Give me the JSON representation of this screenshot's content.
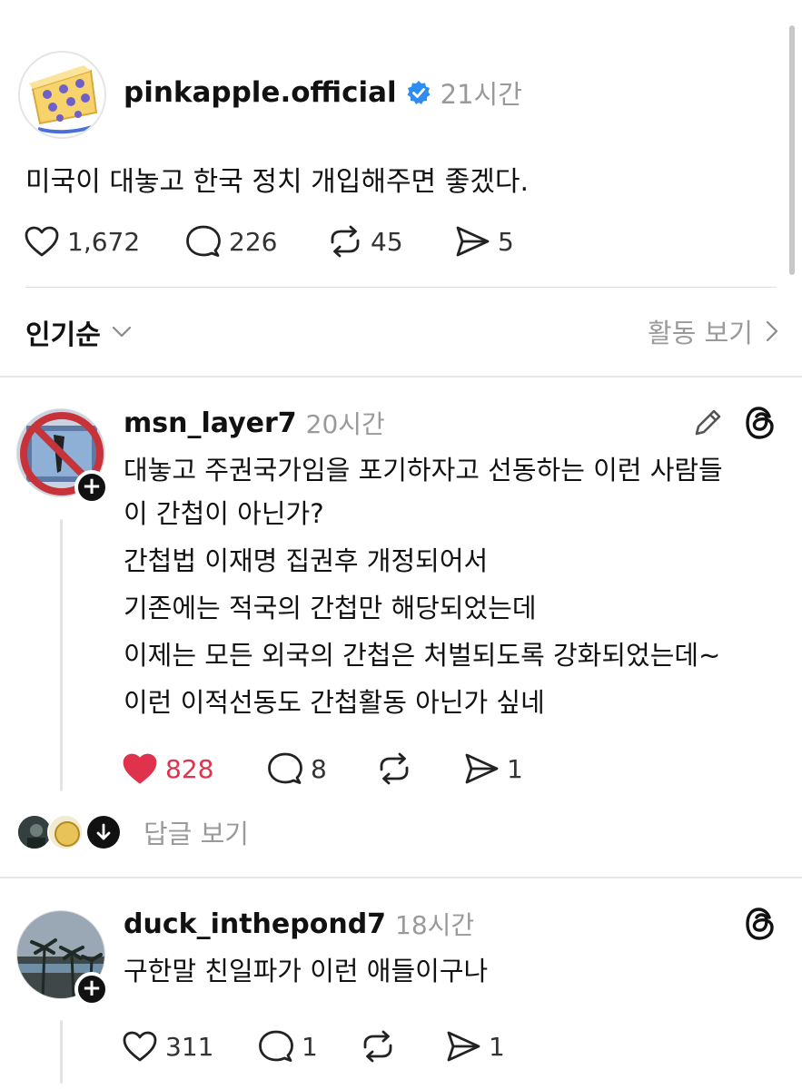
{
  "post": {
    "username": "pinkapple.official",
    "time": "21시간",
    "text": "미국이 대놓고 한국 정치 개입해주면 좋겠다.",
    "likes": "1,672",
    "comments": "226",
    "reposts": "45",
    "shares": "5"
  },
  "sort": {
    "label": "인기순",
    "activity_link": "활동 보기"
  },
  "replies": [
    {
      "username": "msn_layer7",
      "time": "20시간",
      "lines": [
        "대놓고 주권국가임을 포기하자고 선동하는 이런 사람들",
        "이 간첩이 아닌가?",
        "간첩법 이재명 집권후 개정되어서",
        "기존에는 적국의 간첩만 해당되었는데",
        "이제는 모든 외국의 간첩은 처벌되도록 강화되었는데~",
        "이런 이적선동도 간첩활동 아닌가 싶네"
      ],
      "likes": "828",
      "comments": "8",
      "shares": "1",
      "liked": true,
      "see_replies": "답글 보기"
    },
    {
      "username": "duck_inthepond7",
      "time": "18시간",
      "lines": [
        "구한말 친일파가 이런 애들이구나"
      ],
      "likes": "311",
      "comments": "1",
      "shares": "1",
      "liked": false
    }
  ],
  "icons": {
    "verified": "verified-badge-icon",
    "like": "heart-icon",
    "comment": "comment-bubble-icon",
    "repost": "repost-icon",
    "share": "send-icon",
    "edit": "pencil-icon",
    "threads": "threads-logo-icon",
    "chevron": "chevron-icon",
    "down": "down-arrow-icon"
  },
  "colors": {
    "accent_like": "#e0324d",
    "verified_blue": "#2f8cf0",
    "muted_text": "#9a9a9a"
  }
}
